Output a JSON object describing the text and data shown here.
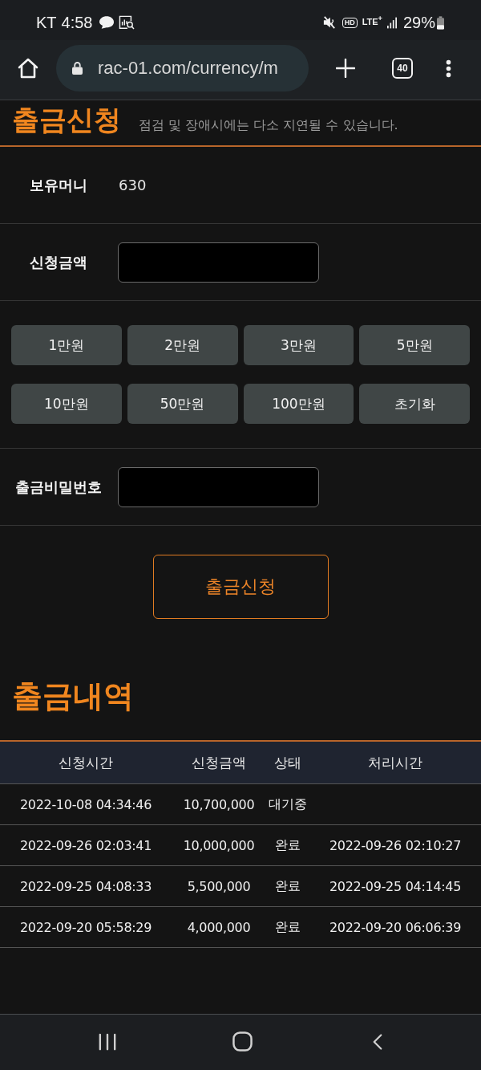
{
  "status_bar": {
    "carrier": "KT",
    "time": "4:58",
    "hd": "HD",
    "network": "LTE$^{+}$",
    "battery": "29%"
  },
  "browser": {
    "url": "rac-01.com/currency/m",
    "tab_count": "40"
  },
  "page": {
    "title": "출금신청",
    "notice": "점검 및 장애시에는 다소 지연될 수 있습니다."
  },
  "form": {
    "balance": {
      "label": "보유머니",
      "value": "630"
    },
    "amount": {
      "label": "신청금액"
    },
    "quick_amounts": [
      "1만원",
      "2만원",
      "3만원",
      "5만원",
      "10만원",
      "50만원",
      "100만원",
      "초기화"
    ],
    "password": {
      "label": "출금비밀번호"
    },
    "submit": "출금신청"
  },
  "history": {
    "title": "출금내역",
    "columns": [
      "신청시간",
      "신청금액",
      "상태",
      "처리시간"
    ],
    "rows": [
      {
        "requested_at": "2022-10-08 04:34:46",
        "amount": "10,700,000",
        "status": "대기중"
      },
      {
        "requested_at": "2022-09-26 02:03:41",
        "amount": "10,000,000",
        "status": "완료",
        "processed_at": "2022-09-26 02:10:27"
      },
      {
        "requested_at": "2022-09-25 04:08:33",
        "amount": "5,500,000",
        "status": "완료",
        "processed_at": "2022-09-25 04:14:45"
      },
      {
        "requested_at": "2022-09-20 05:58:29",
        "amount": "4,000,000",
        "status": "완료",
        "processed_at": "2022-09-20 06:06:39"
      }
    ]
  }
}
